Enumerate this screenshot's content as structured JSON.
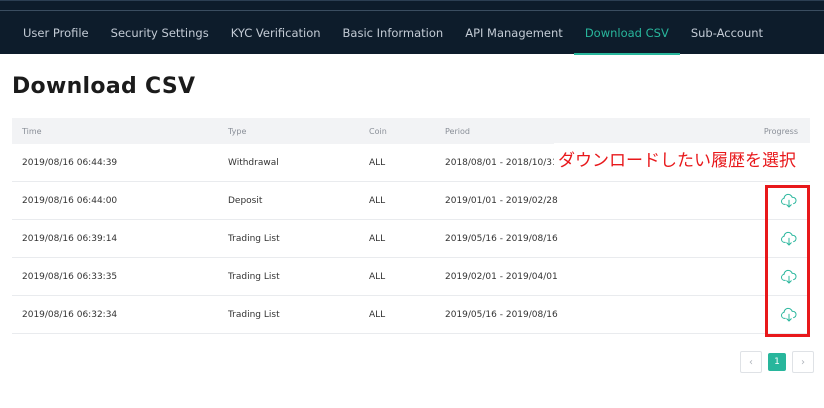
{
  "nav": {
    "items": [
      {
        "label": "User Profile",
        "active": false
      },
      {
        "label": "Security Settings",
        "active": false
      },
      {
        "label": "KYC Verification",
        "active": false
      },
      {
        "label": "Basic Information",
        "active": false
      },
      {
        "label": "API Management",
        "active": false
      },
      {
        "label": "Download CSV",
        "active": true
      },
      {
        "label": "Sub-Account",
        "active": false
      }
    ]
  },
  "page": {
    "title": "Download CSV"
  },
  "table": {
    "headers": {
      "time": "Time",
      "type": "Type",
      "coin": "Coin",
      "period": "Period",
      "progress": "Progress"
    },
    "rows": [
      {
        "time": "2019/08/16 06:44:39",
        "type": "Withdrawal",
        "coin": "ALL",
        "period": "2018/08/01 - 2018/10/31",
        "download": false
      },
      {
        "time": "2019/08/16 06:44:00",
        "type": "Deposit",
        "coin": "ALL",
        "period": "2019/01/01 - 2019/02/28",
        "download": true
      },
      {
        "time": "2019/08/16 06:39:14",
        "type": "Trading List",
        "coin": "ALL",
        "period": "2019/05/16 - 2019/08/16",
        "download": true
      },
      {
        "time": "2019/08/16 06:33:35",
        "type": "Trading List",
        "coin": "ALL",
        "period": "2019/02/01 - 2019/04/01",
        "download": true
      },
      {
        "time": "2019/08/16 06:32:34",
        "type": "Trading List",
        "coin": "ALL",
        "period": "2019/05/16 - 2019/08/16",
        "download": true
      }
    ]
  },
  "annotation": {
    "text": "ダウンロードしたい履歴を選択",
    "color": "#e8181b"
  },
  "pagination": {
    "prev": "‹",
    "current": "1",
    "next": "›"
  },
  "colors": {
    "accent": "#28b69c",
    "topbar": "#0d1c2b"
  },
  "icons": {
    "download": "cloud-download-icon"
  }
}
